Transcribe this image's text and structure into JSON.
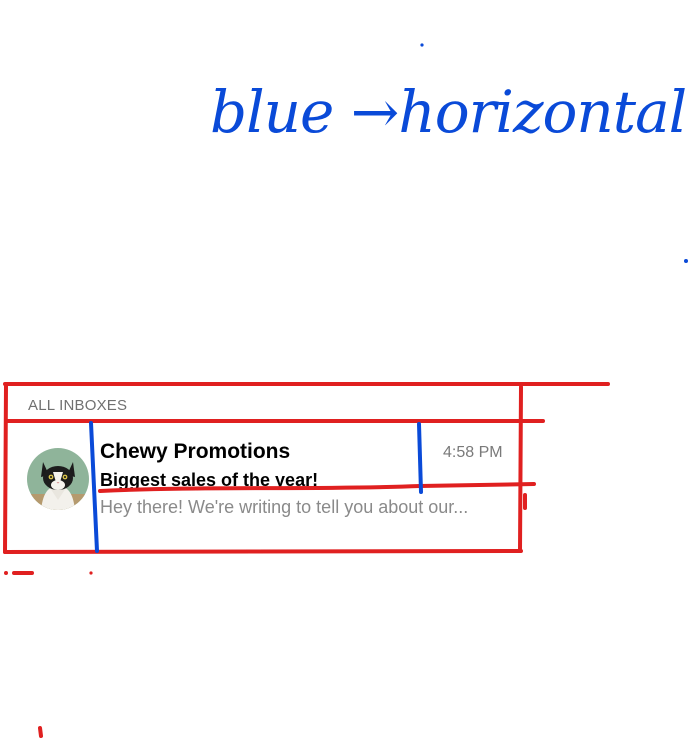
{
  "annotation": {
    "note": "blue →horizontal",
    "colors": {
      "blue_marker": "#0a4ad8",
      "red_marker": "#e02020"
    }
  },
  "inbox": {
    "section_title": "ALL INBOXES",
    "messages": [
      {
        "sender": "Chewy Promotions",
        "time": "4:58 PM",
        "subject": "Biggest sales of the year!",
        "preview": "Hey there! We're writing to tell you about our...",
        "avatar": "cat-photo-avatar"
      }
    ]
  }
}
